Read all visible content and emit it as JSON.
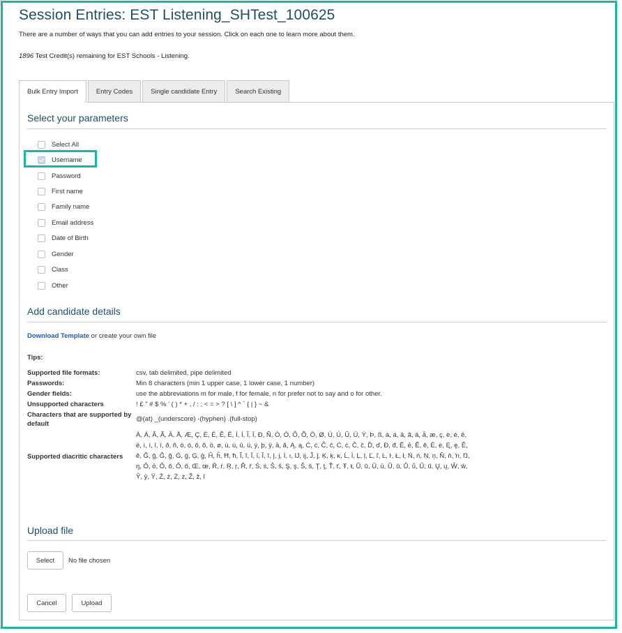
{
  "page": {
    "title": "Session Entries: EST Listening_SHTest_100625",
    "intro": "There are a number of ways that you can add entries to your session. Click on each one to learn more about them.",
    "credits_number": "1896",
    "credits_text": " Test Credit(s) remaining for EST Schools - Listening."
  },
  "tabs": [
    {
      "label": "Bulk Entry Import",
      "active": true
    },
    {
      "label": "Entry Codes",
      "active": false
    },
    {
      "label": "Single candidate Entry",
      "active": false
    },
    {
      "label": "Search Existing",
      "active": false
    }
  ],
  "parameters": {
    "heading": "Select your parameters",
    "items": [
      {
        "label": "Select All",
        "checked": false
      },
      {
        "label": "Username",
        "checked": true,
        "highlighted": true
      },
      {
        "label": "Password",
        "checked": false
      },
      {
        "label": "First name",
        "checked": false
      },
      {
        "label": "Family name",
        "checked": false
      },
      {
        "label": "Email address",
        "checked": false
      },
      {
        "label": "Date of Birth",
        "checked": false
      },
      {
        "label": "Gender",
        "checked": false
      },
      {
        "label": "Class",
        "checked": false
      },
      {
        "label": "Other",
        "checked": false
      }
    ]
  },
  "candidate": {
    "heading": "Add candidate details",
    "download_link": "Download Template",
    "download_rest": " or create your own file",
    "tips_label": "Tips:",
    "tips": [
      {
        "label": "Supported file formats:",
        "value": "csv, tab delimited, pipe delimited"
      },
      {
        "label": "Passwords:",
        "value": "Min 8 characters (min 1 upper case, 1 lower case, 1 number)"
      },
      {
        "label": "Gender fields:",
        "value": "use the abbreviations m for male, f for female, n for prefer not to say and o for other."
      },
      {
        "label": "Unsupported characters",
        "value": "! £ \" # $ % ' ( ) * + , / : ; < = > ? [ \\ ] ^ ` { | } ~ &"
      },
      {
        "label": "Characters that are supported by default",
        "value": "@(at) _(underscore) -(hyphen) .(full-stop)"
      }
    ],
    "diacritics_label": "Supported diacritic characters",
    "diacritics": "À, Á, Â, Ã, Ä, Å, Æ, Ç, È, É, Ê, Ë, Ì, Í, Î, Ï, Ð, Ñ, Ò, Ó, Ô, Õ, Ö, Ø, Ù, Ú, Û, Ü, Ý, Þ, ß, à, á, â, ã, ä, å, æ, ç, è, é, ê, ë, ì, í, î, ï, ð, ñ, ò, ó, ô, õ, ö, ø, ù, ú, û, ü, ý, þ, ÿ, ā, ă, Ą, ą, Ć, ć, Ĉ, ĉ, Ċ, ċ, Č, č, Ď, ď, Đ, đ, Ē, ē, Ĕ, ĕ, Ė, ė, Ę, ę, Ě, ě, Ĝ, ĝ, Ğ, ğ, Ġ, ġ, Ģ, ģ, Ĥ, ĥ, Ħ, ħ, Ĩ, ĩ, Ī, ī, Ĭ, ĭ, Į, į, İ, ı, Ĳ, ĳ, Ĵ, ĵ, Ķ, ķ, ĸ, Ĺ, ĺ, Ļ, ļ, Ľ, ľ, Ŀ, ŀ, Ł, ł, Ń, ń, Ņ, ņ, Ň, ň, ŉ, Ŋ, ŋ, Ō, ō, Ŏ, ŏ, Ő, ő, Œ, œ, Ŕ, ŕ, Ŗ, ŗ, Ř, ř, Ś, ś, Ŝ, ŝ, Ş, ş, Š, š, Ţ, ţ, Ť, ť, Ŧ, ŧ, Ũ, ũ, Ū, ū, Ŭ, ŭ, Ů, ů, Ű, ű, Ų, ų, Ŵ, ŵ, Ŷ, ŷ, Ÿ, Ź, ź, Ż, ż, Ž, ž, ſ"
  },
  "upload": {
    "heading": "Upload file",
    "select_label": "Select",
    "file_status": "No file chosen",
    "cancel_label": "Cancel",
    "upload_label": "Upload"
  }
}
